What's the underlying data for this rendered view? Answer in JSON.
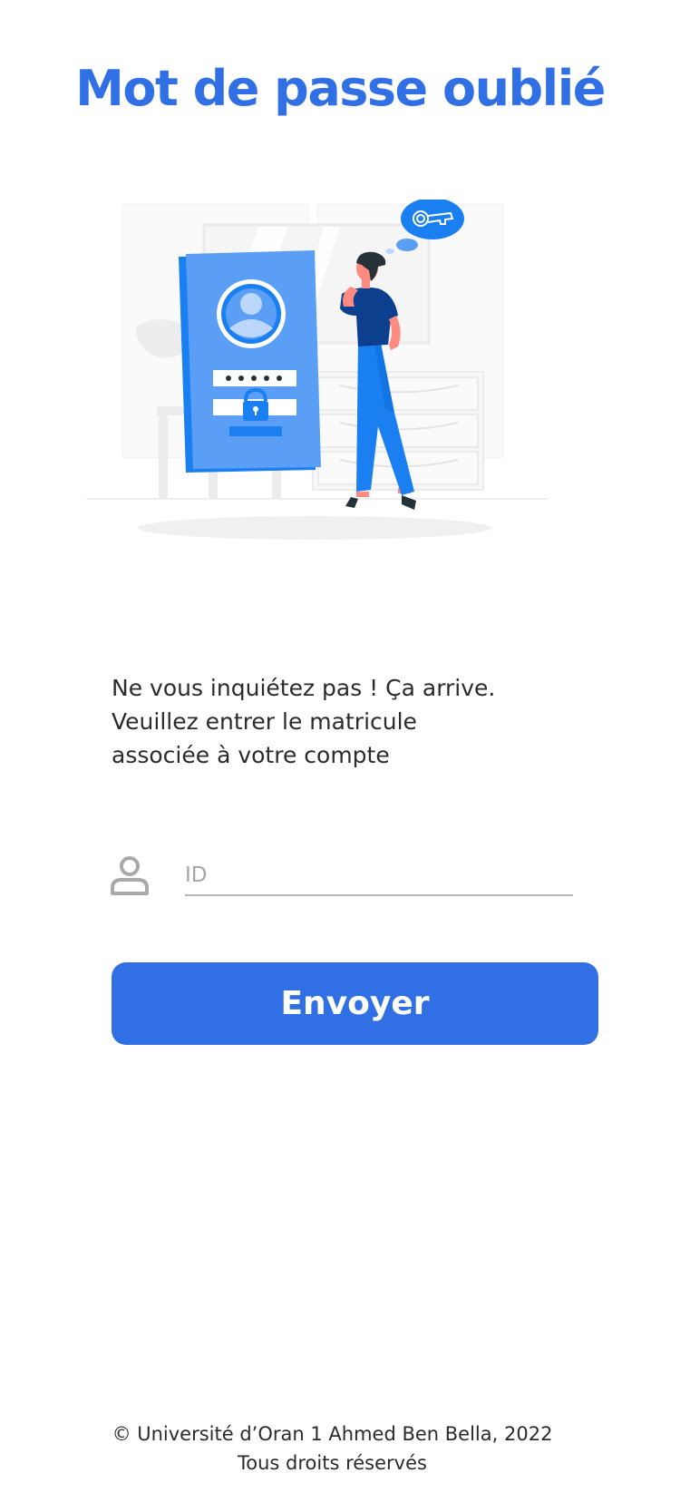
{
  "page": {
    "title": "Mot de passe oublié"
  },
  "illustration": {
    "name": "forgot-password-illustration",
    "icons": [
      "key-icon",
      "lock-icon",
      "user-icon"
    ]
  },
  "message": {
    "line1": "Ne vous inquiétez pas ! Ça arrive.",
    "line2": "Veuillez entrer le matricule",
    "line3": "associée à votre compte"
  },
  "form": {
    "id_icon": "person-icon",
    "id_placeholder": "ID",
    "id_value": "",
    "submit_label": "Envoyer"
  },
  "footer": {
    "copyright": "© Université d’Oran 1 Ahmed Ben Bella, 2022",
    "rights": "Tous droits réservés"
  },
  "colors": {
    "accent": "#3170e4",
    "illustration_blue": "#1a7ff0",
    "illustration_light_blue": "#5a9ff5",
    "text": "#2b2b2b",
    "placeholder": "#a6a6a6"
  }
}
